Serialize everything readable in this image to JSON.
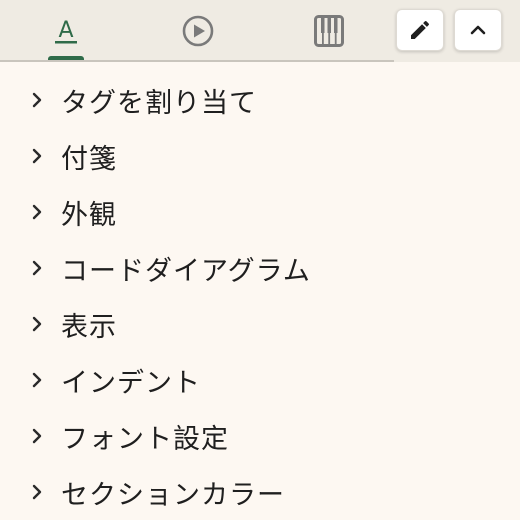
{
  "toolbar": {
    "tabs": [
      {
        "icon": "text-format-icon",
        "label": "A",
        "active": true
      },
      {
        "icon": "play-circle-icon",
        "active": false
      },
      {
        "icon": "piano-keys-icon",
        "active": false
      }
    ],
    "buttons": [
      {
        "icon": "pencil-icon"
      },
      {
        "icon": "chevron-up-icon"
      }
    ],
    "accent_color": "#2f6b49"
  },
  "menu": {
    "items": [
      {
        "label": "タグを割り当て"
      },
      {
        "label": "付箋"
      },
      {
        "label": "外観"
      },
      {
        "label": "コードダイアグラム"
      },
      {
        "label": "表示"
      },
      {
        "label": "インデント"
      },
      {
        "label": "フォント設定"
      },
      {
        "label": "セクションカラー"
      }
    ]
  }
}
